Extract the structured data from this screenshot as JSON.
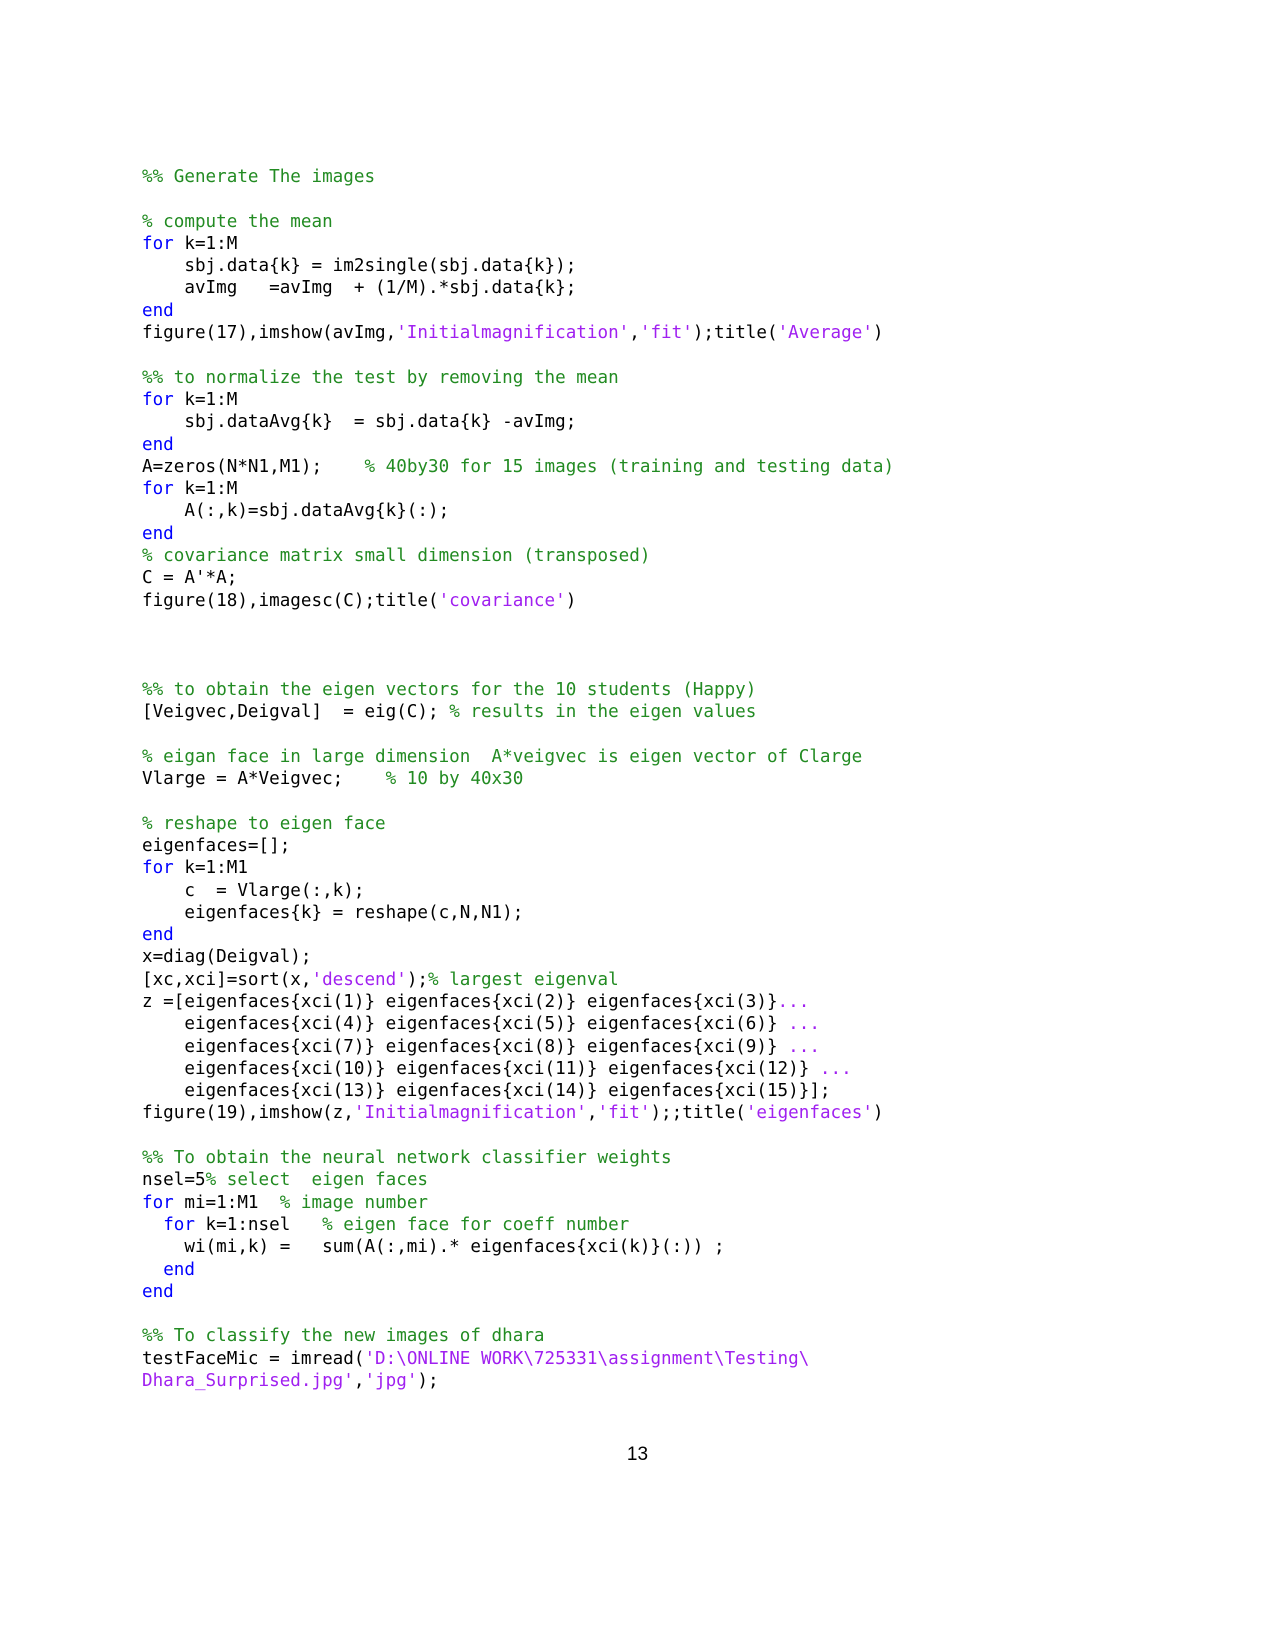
{
  "document": {
    "page_number": "13",
    "language": "matlab",
    "colors": {
      "keyword": "#0000ff",
      "comment": "#228b22",
      "string": "#a020f0",
      "normal": "#000000",
      "background": "#ffffff"
    }
  },
  "code": {
    "lines": [
      {
        "segments": [
          {
            "t": "cmt",
            "s": "%% Generate The images"
          }
        ]
      },
      {
        "segments": [
          {
            "t": "norm",
            "s": ""
          }
        ]
      },
      {
        "segments": [
          {
            "t": "cmt",
            "s": "% compute the mean"
          }
        ]
      },
      {
        "segments": [
          {
            "t": "kw",
            "s": "for"
          },
          {
            "t": "norm",
            "s": " k=1:M"
          }
        ]
      },
      {
        "segments": [
          {
            "t": "norm",
            "s": "    sbj.data{k} = im2single(sbj.data{k});"
          }
        ]
      },
      {
        "segments": [
          {
            "t": "norm",
            "s": "    avImg   =avImg  + (1/M).*sbj.data{k};"
          }
        ]
      },
      {
        "segments": [
          {
            "t": "kw",
            "s": "end"
          }
        ]
      },
      {
        "segments": [
          {
            "t": "norm",
            "s": "figure(17),imshow(avImg,"
          },
          {
            "t": "str",
            "s": "'Initialmagnification'"
          },
          {
            "t": "norm",
            "s": ","
          },
          {
            "t": "str",
            "s": "'fit'"
          },
          {
            "t": "norm",
            "s": ");title("
          },
          {
            "t": "str",
            "s": "'Average'"
          },
          {
            "t": "norm",
            "s": ")"
          }
        ]
      },
      {
        "segments": [
          {
            "t": "norm",
            "s": ""
          }
        ]
      },
      {
        "segments": [
          {
            "t": "cmt",
            "s": "%% to normalize the test by removing the mean"
          }
        ]
      },
      {
        "segments": [
          {
            "t": "kw",
            "s": "for"
          },
          {
            "t": "norm",
            "s": " k=1:M"
          }
        ]
      },
      {
        "segments": [
          {
            "t": "norm",
            "s": "    sbj.dataAvg{k}  = sbj.data{k} -avImg;"
          }
        ]
      },
      {
        "segments": [
          {
            "t": "kw",
            "s": "end"
          }
        ]
      },
      {
        "segments": [
          {
            "t": "norm",
            "s": "A=zeros(N*N1,M1);    "
          },
          {
            "t": "cmt",
            "s": "% 40by30 for 15 images (training and testing data)"
          }
        ]
      },
      {
        "segments": [
          {
            "t": "kw",
            "s": "for"
          },
          {
            "t": "norm",
            "s": " k=1:M"
          }
        ]
      },
      {
        "segments": [
          {
            "t": "norm",
            "s": "    A(:,k)=sbj.dataAvg{k}(:);"
          }
        ]
      },
      {
        "segments": [
          {
            "t": "kw",
            "s": "end"
          }
        ]
      },
      {
        "segments": [
          {
            "t": "cmt",
            "s": "% covariance matrix small dimension (transposed)"
          }
        ]
      },
      {
        "segments": [
          {
            "t": "norm",
            "s": "C = A'*A;"
          }
        ]
      },
      {
        "segments": [
          {
            "t": "norm",
            "s": "figure(18),imagesc(C);title("
          },
          {
            "t": "str",
            "s": "'covariance'"
          },
          {
            "t": "norm",
            "s": ")"
          }
        ]
      },
      {
        "segments": [
          {
            "t": "norm",
            "s": ""
          }
        ]
      },
      {
        "segments": [
          {
            "t": "norm",
            "s": ""
          }
        ]
      },
      {
        "segments": [
          {
            "t": "norm",
            "s": ""
          }
        ]
      },
      {
        "segments": [
          {
            "t": "cmt",
            "s": "%% to obtain the eigen vectors for the 10 students (Happy)"
          }
        ]
      },
      {
        "segments": [
          {
            "t": "norm",
            "s": "[Veigvec,Deigval]  = eig(C); "
          },
          {
            "t": "cmt",
            "s": "% results in the eigen values"
          }
        ]
      },
      {
        "segments": [
          {
            "t": "norm",
            "s": ""
          }
        ]
      },
      {
        "segments": [
          {
            "t": "cmt",
            "s": "% eigan face in large dimension  A*veigvec is eigen vector of Clarge"
          }
        ]
      },
      {
        "segments": [
          {
            "t": "norm",
            "s": "Vlarge = A*Veigvec;    "
          },
          {
            "t": "cmt",
            "s": "% 10 by 40x30"
          }
        ]
      },
      {
        "segments": [
          {
            "t": "norm",
            "s": ""
          }
        ]
      },
      {
        "segments": [
          {
            "t": "cmt",
            "s": "% reshape to eigen face"
          }
        ]
      },
      {
        "segments": [
          {
            "t": "norm",
            "s": "eigenfaces=[];"
          }
        ]
      },
      {
        "segments": [
          {
            "t": "kw",
            "s": "for"
          },
          {
            "t": "norm",
            "s": " k=1:M1"
          }
        ]
      },
      {
        "segments": [
          {
            "t": "norm",
            "s": "    c  = Vlarge(:,k);"
          }
        ]
      },
      {
        "segments": [
          {
            "t": "norm",
            "s": "    eigenfaces{k} = reshape(c,N,N1);"
          }
        ]
      },
      {
        "segments": [
          {
            "t": "kw",
            "s": "end"
          }
        ]
      },
      {
        "segments": [
          {
            "t": "norm",
            "s": "x=diag(Deigval);"
          }
        ]
      },
      {
        "segments": [
          {
            "t": "norm",
            "s": "[xc,xci]=sort(x,"
          },
          {
            "t": "str",
            "s": "'descend'"
          },
          {
            "t": "norm",
            "s": ");"
          },
          {
            "t": "cmt",
            "s": "% largest eigenval"
          }
        ]
      },
      {
        "segments": [
          {
            "t": "norm",
            "s": "z =[eigenfaces{xci(1)} eigenfaces{xci(2)} eigenfaces{xci(3)}"
          },
          {
            "t": "cont",
            "s": "..."
          }
        ]
      },
      {
        "segments": [
          {
            "t": "norm",
            "s": "    eigenfaces{xci(4)} eigenfaces{xci(5)} eigenfaces{xci(6)} "
          },
          {
            "t": "cont",
            "s": "..."
          }
        ]
      },
      {
        "segments": [
          {
            "t": "norm",
            "s": "    eigenfaces{xci(7)} eigenfaces{xci(8)} eigenfaces{xci(9)} "
          },
          {
            "t": "cont",
            "s": "..."
          }
        ]
      },
      {
        "segments": [
          {
            "t": "norm",
            "s": "    eigenfaces{xci(10)} eigenfaces{xci(11)} eigenfaces{xci(12)} "
          },
          {
            "t": "cont",
            "s": "..."
          }
        ]
      },
      {
        "segments": [
          {
            "t": "norm",
            "s": "    eigenfaces{xci(13)} eigenfaces{xci(14)} eigenfaces{xci(15)}];"
          }
        ]
      },
      {
        "segments": [
          {
            "t": "norm",
            "s": "figure(19),imshow(z,"
          },
          {
            "t": "str",
            "s": "'Initialmagnification'"
          },
          {
            "t": "norm",
            "s": ","
          },
          {
            "t": "str",
            "s": "'fit'"
          },
          {
            "t": "norm",
            "s": ");;title("
          },
          {
            "t": "str",
            "s": "'eigenfaces'"
          },
          {
            "t": "norm",
            "s": ")"
          }
        ]
      },
      {
        "segments": [
          {
            "t": "norm",
            "s": ""
          }
        ]
      },
      {
        "segments": [
          {
            "t": "cmt",
            "s": "%% To obtain the neural network classifier weights"
          }
        ]
      },
      {
        "segments": [
          {
            "t": "norm",
            "s": "nsel=5"
          },
          {
            "t": "cmt",
            "s": "% select  eigen faces"
          }
        ]
      },
      {
        "segments": [
          {
            "t": "kw",
            "s": "for"
          },
          {
            "t": "norm",
            "s": " mi=1:M1  "
          },
          {
            "t": "cmt",
            "s": "% image number"
          }
        ]
      },
      {
        "segments": [
          {
            "t": "norm",
            "s": "  "
          },
          {
            "t": "kw",
            "s": "for"
          },
          {
            "t": "norm",
            "s": " k=1:nsel   "
          },
          {
            "t": "cmt",
            "s": "% eigen face for coeff number"
          }
        ]
      },
      {
        "segments": [
          {
            "t": "norm",
            "s": "    wi(mi,k) =   sum(A(:,mi).* eigenfaces{xci(k)}(:)) ;"
          }
        ]
      },
      {
        "segments": [
          {
            "t": "norm",
            "s": "  "
          },
          {
            "t": "kw",
            "s": "end"
          }
        ]
      },
      {
        "segments": [
          {
            "t": "kw",
            "s": "end"
          }
        ]
      },
      {
        "segments": [
          {
            "t": "norm",
            "s": ""
          }
        ]
      },
      {
        "segments": [
          {
            "t": "cmt",
            "s": "%% To classify the new images of dhara"
          }
        ]
      },
      {
        "segments": [
          {
            "t": "norm",
            "s": "testFaceMic = imread("
          },
          {
            "t": "str",
            "s": "'D:\\ONLINE WORK\\725331\\assignment\\Testing\\"
          }
        ]
      },
      {
        "segments": [
          {
            "t": "str",
            "s": "Dhara_Surprised.jpg'"
          },
          {
            "t": "norm",
            "s": ","
          },
          {
            "t": "str",
            "s": "'jpg'"
          },
          {
            "t": "norm",
            "s": ");"
          }
        ]
      }
    ]
  }
}
